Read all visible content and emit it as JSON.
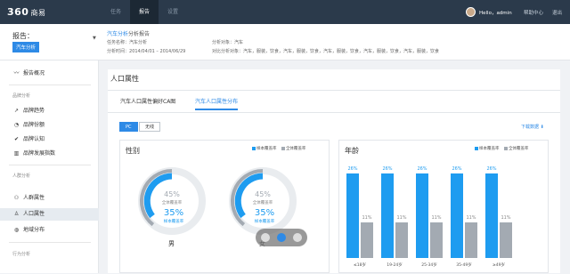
{
  "topbar": {
    "logo": "360",
    "logo_sub": "商易",
    "nav": [
      "任务",
      "报告",
      "设置"
    ],
    "active_nav": "报告",
    "user": "Hello，admin",
    "links": [
      "帮助中心",
      "退出"
    ]
  },
  "subheader": {
    "report_label": "报告：",
    "report_name": "汽车分析",
    "title_highlight": "汽车分析",
    "title_rest": "分析报告",
    "meta": {
      "task_name_label": "任务名称：",
      "task_name": "汽车分析",
      "analysis_time_label": "分析时间：",
      "analysis_time": "2014/04/01 – 2014/06/29",
      "analysis_obj_label": "分析对象：",
      "analysis_obj": "汽车",
      "compare_obj_label": "对比分析对象：",
      "compare_obj": "汽车，服装，饮食，汽车，服装，饮食，汽车，服装，饮食，汽车，服装，饮食，汽车，服装，饮食"
    }
  },
  "sidebar": {
    "overview": "报告概况",
    "sections": [
      {
        "title": "品牌分析",
        "items": [
          "品牌趋势",
          "品牌份额",
          "品牌认知",
          "品牌发展指数"
        ]
      },
      {
        "title": "人群分析",
        "items": [
          "人群属性",
          "人口属性",
          "地域分布"
        ]
      },
      {
        "title": "行为分析",
        "items": []
      }
    ],
    "active_item": "人口属性"
  },
  "main": {
    "page_title": "人口属性",
    "tabs": [
      "汽车人口属性偏好CA图",
      "汽车人口属性分布"
    ],
    "active_tab": "汽车人口属性分布",
    "segments": [
      "PC",
      "无线"
    ],
    "active_segment": "PC",
    "download": "下载数据"
  },
  "legend": {
    "sample": "样本覆盖率",
    "overall": "全体覆盖率"
  },
  "gender": {
    "title": "性别",
    "items": [
      {
        "label": "男",
        "overall_pct": "45%",
        "overall_label": "全体覆盖率",
        "sample_pct": "35%",
        "sample_label": "样本覆盖率"
      },
      {
        "label": "女",
        "overall_pct": "45%",
        "overall_label": "全体覆盖率",
        "sample_pct": "35%",
        "sample_label": "样本覆盖率"
      }
    ]
  },
  "chart_data": {
    "type": "bar",
    "title": "年龄",
    "categories": [
      "≤18岁",
      "19-24岁",
      "25-34岁",
      "35-49岁",
      "≥49岁"
    ],
    "series": [
      {
        "name": "样本覆盖率",
        "values": [
          26,
          26,
          26,
          26,
          26
        ],
        "color": "#1e9cf0"
      },
      {
        "name": "全体覆盖率",
        "values": [
          11,
          11,
          11,
          11,
          11
        ],
        "color": "#a3aab2"
      }
    ],
    "ylim": [
      0,
      30
    ],
    "legend_position": "top-right"
  },
  "carousel": {
    "count": 3,
    "active_index": 1
  },
  "colors": {
    "accent": "#2e8ae6",
    "topbar": "#2b3a4b",
    "sample": "#1e9cf0",
    "overall": "#a3aab2"
  }
}
